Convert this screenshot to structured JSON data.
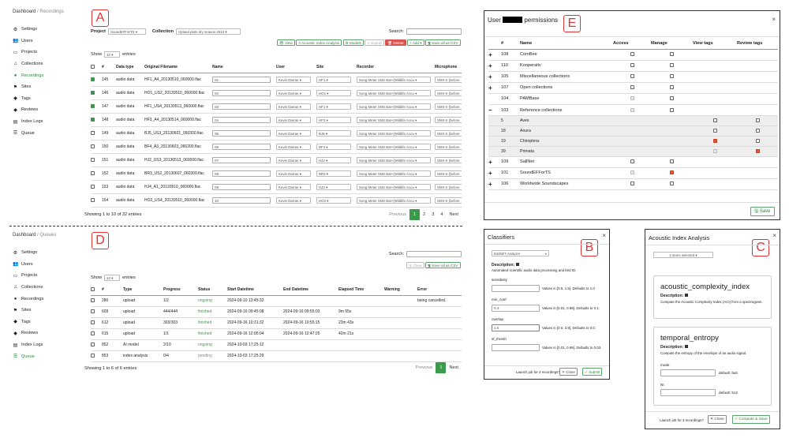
{
  "labels": {
    "a": "A",
    "b": "B",
    "c": "C",
    "d": "D",
    "e": "E"
  },
  "panel_a": {
    "breadcrumb": {
      "home": "Dashboard",
      "current": "Recordings"
    },
    "sidebar": [
      {
        "label": "Settings",
        "icon": "gear-icon",
        "glyph": "⚙",
        "active": false
      },
      {
        "label": "Users",
        "icon": "users-icon",
        "glyph": "👥",
        "active": false
      },
      {
        "label": "Projects",
        "icon": "monitor-icon",
        "glyph": "▭",
        "active": false
      },
      {
        "label": "Collections",
        "icon": "music-icon",
        "glyph": "♫",
        "active": false
      },
      {
        "label": "Recordings",
        "icon": "record-icon",
        "glyph": "●",
        "active": true
      },
      {
        "label": "Sites",
        "icon": "sites-icon",
        "glyph": "⚑",
        "active": false
      },
      {
        "label": "Tags",
        "icon": "tag-icon",
        "glyph": "◆",
        "active": false
      },
      {
        "label": "Reviews",
        "icon": "reviews-icon",
        "glyph": "◆",
        "active": false
      },
      {
        "label": "Index Logs",
        "icon": "index-logs-icon",
        "glyph": "▤",
        "active": false
      },
      {
        "label": "Queue",
        "icon": "queue-icon",
        "glyph": "☰",
        "active": false
      }
    ],
    "project_label": "Project",
    "project_value": "SoundEFForTS",
    "collection_label": "Collection",
    "collection_value": "Upland plots dry season 2013",
    "search_label": "Search:",
    "toolbar": {
      "view": "View",
      "aci": "Acoustic Index Analysis",
      "models": "Models",
      "export": "Export",
      "delete": "Delete",
      "add": "Add",
      "save_csv": "Save all as CSV"
    },
    "show": "Show",
    "show_value": "10",
    "entries": "entries",
    "columns": [
      "#",
      "Data type",
      "Original Filename",
      "Name",
      "User",
      "Site",
      "Recorder",
      "Microphone"
    ],
    "rows": [
      {
        "checked": true,
        "id": "145",
        "type": "audio data",
        "file": "HF1_A4_20130510_060000.flac",
        "name": "01",
        "user": "Kevin Darras",
        "site": "HF1",
        "recorder": "Song Meter SM2 Bat+(Wildlife Acou",
        "mic": "SMX-II (before"
      },
      {
        "checked": true,
        "id": "146",
        "type": "audio data",
        "file": "HO1_US2_20130510_060000.flac",
        "name": "02",
        "user": "Kevin Darras",
        "site": "HO1",
        "recorder": "Song Meter SM2 Bat+(Wildlife Acou",
        "mic": "SMX-II (before"
      },
      {
        "checked": true,
        "id": "147",
        "type": "audio data",
        "file": "HF1_US4_20130513_060000.flac",
        "name": "03",
        "user": "Kevin Darras",
        "site": "HF1",
        "recorder": "Song Meter SM2 Bat+(Wildlife Acou",
        "mic": "SMX-II (before"
      },
      {
        "checked": true,
        "id": "148",
        "type": "audio data",
        "file": "HF3_A4_20130514_060000.flac",
        "name": "04",
        "user": "Kevin Darras",
        "site": "HF3",
        "recorder": "Song Meter SM2 Bat+(Wildlife Acou",
        "mic": "SMX-II (before"
      },
      {
        "checked": false,
        "id": "149",
        "type": "audio data",
        "file": "BJ5_US3_20130601_060300.flac",
        "name": "05",
        "user": "Kevin Darras",
        "site": "BJ5",
        "recorder": "Song Meter SM2 Bat+(Wildlife Acou",
        "mic": "SMX-II (before"
      },
      {
        "checked": false,
        "id": "150",
        "type": "audio data",
        "file": "BF4_A3_20130603_060200.flac",
        "name": "06",
        "user": "Kevin Darras",
        "site": "BF4",
        "recorder": "Song Meter SM2 Bat+(Wildlife Acou",
        "mic": "SMX-II (before"
      },
      {
        "checked": false,
        "id": "151",
        "type": "audio data",
        "file": "HJ2_US3_20130513_060000.flac",
        "name": "07",
        "user": "Kevin Darras",
        "site": "HJ2",
        "recorder": "Song Meter SM2 Bat+(Wildlife Acou",
        "mic": "SMX-II (before"
      },
      {
        "checked": false,
        "id": "152",
        "type": "audio data",
        "file": "BR3_US2_20130607_060300.flac",
        "name": "08",
        "user": "Kevin Darras",
        "site": "BR3",
        "recorder": "Song Meter SM2 Bat+(Wildlife Acou",
        "mic": "SMX-II (before"
      },
      {
        "checked": false,
        "id": "153",
        "type": "audio data",
        "file": "HJ4_A1_20130510_060000.flac",
        "name": "09",
        "user": "Kevin Darras",
        "site": "HJ4",
        "recorder": "Song Meter SM2 Bat+(Wildlife Acou",
        "mic": "SMX-II (before"
      },
      {
        "checked": false,
        "id": "154",
        "type": "audio data",
        "file": "HO2_US4_20130510_060000.flac",
        "name": "10",
        "user": "Kevin Darras",
        "site": "HO2",
        "recorder": "Song Meter SM2 Bat+(Wildlife Acou",
        "mic": "SMX-II (before"
      }
    ],
    "footer": "Showing 1 to 10 of 32 entries",
    "pagination": [
      "Previous",
      "1",
      "2",
      "3",
      "4",
      "Next"
    ]
  },
  "panel_d": {
    "breadcrumb": {
      "home": "Dashboard",
      "current": "Queues"
    },
    "sidebar": [
      {
        "label": "Settings",
        "icon": "gear-icon",
        "glyph": "⚙",
        "active": false
      },
      {
        "label": "Users",
        "icon": "users-icon",
        "glyph": "👥",
        "active": false
      },
      {
        "label": "Projects",
        "icon": "monitor-icon",
        "glyph": "▭",
        "active": false
      },
      {
        "label": "Collections",
        "icon": "music-icon",
        "glyph": "♫",
        "active": false
      },
      {
        "label": "Recordings",
        "icon": "record-icon",
        "glyph": "●",
        "active": false
      },
      {
        "label": "Sites",
        "icon": "sites-icon",
        "glyph": "⚑",
        "active": false
      },
      {
        "label": "Tags",
        "icon": "tag-icon",
        "glyph": "◆",
        "active": false
      },
      {
        "label": "Reviews",
        "icon": "reviews-icon",
        "glyph": "◆",
        "active": false
      },
      {
        "label": "Index Logs",
        "icon": "index-logs-icon",
        "glyph": "▤",
        "active": false
      },
      {
        "label": "Queue",
        "icon": "queue-icon",
        "glyph": "☰",
        "active": true
      }
    ],
    "search_label": "Search:",
    "toolbar": {
      "clear": "Clear",
      "save_csv": "Save all as CSV"
    },
    "show": "Show",
    "show_value": "10",
    "entries": "entries",
    "columns": [
      "#",
      "Type",
      "Progress",
      "Status",
      "Start Datetime",
      "End Datetime",
      "Elapsed Time",
      "Warning",
      "Error"
    ],
    "rows": [
      {
        "id": "280",
        "type": "upload",
        "progress": "1/2",
        "status": "ongoing",
        "start": "2024-06-10 13:45:32",
        "end": "",
        "elapsed": "",
        "warning": "",
        "error": "being cancelled."
      },
      {
        "id": "609",
        "type": "upload",
        "progress": "444/444",
        "status": "finished",
        "start": "2024-09-16 09:45:08",
        "end": "2024-09-16 09:55:03",
        "elapsed": "9m 55s",
        "warning": "",
        "error": ""
      },
      {
        "id": "612",
        "type": "upload",
        "progress": "303/303",
        "status": "finished",
        "start": "2024-09-16 10:31:32",
        "end": "2024-09-16 10:55:15",
        "elapsed": "23m 43s",
        "warning": "",
        "error": ""
      },
      {
        "id": "615",
        "type": "upload",
        "progress": "1/1",
        "status": "finished",
        "start": "2024-09-16 12:05:04",
        "end": "2024-09-16 12:47:25",
        "elapsed": "42m 21s",
        "warning": "",
        "error": ""
      },
      {
        "id": "852",
        "type": "AI model",
        "progress": "2/10",
        "status": "ongoing",
        "start": "2024-10-03 17:25:12",
        "end": "",
        "elapsed": "",
        "warning": "",
        "error": ""
      },
      {
        "id": "853",
        "type": "index analysis",
        "progress": "0/4",
        "status": "pending",
        "start": "2024-10-03 17:25:29",
        "end": "",
        "elapsed": "",
        "warning": "",
        "error": ""
      }
    ],
    "footer": "Showing 1 to 6 of 6 entries",
    "pagination": [
      "Previous",
      "1",
      "Next"
    ]
  },
  "panel_e": {
    "title_pre": "User",
    "title_post": "permissions",
    "columns": [
      "#",
      "Name",
      "Access",
      "Manage",
      "View tags",
      "Review tags"
    ],
    "rows": [
      {
        "exp": "+",
        "id": "108",
        "name": "ComBee",
        "sub": false,
        "access": "off",
        "manage": "off",
        "view": "",
        "review": ""
      },
      {
        "exp": "+",
        "id": "110",
        "name": "Kooperativ",
        "sub": false,
        "access": "off",
        "manage": "off",
        "view": "",
        "review": ""
      },
      {
        "exp": "+",
        "id": "105",
        "name": "Miscellaneous collections",
        "sub": false,
        "access": "off",
        "manage": "off",
        "view": "",
        "review": ""
      },
      {
        "exp": "+",
        "id": "107",
        "name": "Open collections",
        "sub": false,
        "access": "off",
        "manage": "off",
        "view": "",
        "review": ""
      },
      {
        "exp": "",
        "id": "104",
        "name": "PAMBase",
        "sub": false,
        "access": "dis",
        "manage": "off",
        "view": "",
        "review": ""
      },
      {
        "exp": "−",
        "id": "103",
        "name": "Reference collections",
        "sub": false,
        "access": "dis",
        "manage": "off",
        "view": "",
        "review": ""
      },
      {
        "exp": "",
        "id": "5",
        "name": "Aves",
        "sub": true,
        "access": "",
        "manage": "",
        "view": "off",
        "review": "off"
      },
      {
        "exp": "",
        "id": "18",
        "name": "Anura",
        "sub": true,
        "access": "",
        "manage": "",
        "view": "off",
        "review": "off"
      },
      {
        "exp": "",
        "id": "19",
        "name": "Chiroptera",
        "sub": true,
        "access": "",
        "manage": "",
        "view": "red",
        "review": "off"
      },
      {
        "exp": "",
        "id": "39",
        "name": "Primata",
        "sub": true,
        "access": "",
        "manage": "",
        "view": "dis",
        "review": "red"
      },
      {
        "exp": "+",
        "id": "109",
        "name": "SallNet",
        "sub": false,
        "access": "off",
        "manage": "off",
        "view": "",
        "review": ""
      },
      {
        "exp": "+",
        "id": "101",
        "name": "SoundEFForTS",
        "sub": false,
        "access": "dis",
        "manage": "red",
        "view": "",
        "review": ""
      },
      {
        "exp": "+",
        "id": "106",
        "name": "Worldwide Soundscapes",
        "sub": false,
        "access": "off",
        "manage": "off",
        "view": "",
        "review": ""
      }
    ],
    "save": "Save"
  },
  "panel_b": {
    "title": "Classifiers",
    "selected": "BirdNET-Analyzer",
    "desc_label": "Description:",
    "desc": "Automated scientific audio data processing and bird ID.",
    "params": [
      {
        "name": "sensitivity",
        "value": "",
        "hint": "Values in [0.5, 1.5]. Defaults to 1.0"
      },
      {
        "name": "min_conf",
        "value": "0.3",
        "hint": "Values in [0.01, 0.99]. Defaults to 0.1."
      },
      {
        "name": "overlap",
        "value": "1.5",
        "hint": "Values in [0.0, 2.9]. Defaults to 0.0."
      },
      {
        "name": "sf_thresh",
        "value": "",
        "hint": "Values in [0.01, 0.99]. Defaults to 0.03."
      }
    ],
    "launch": "Launch job for 3 recordings?",
    "close": "Close",
    "submit": "Submit"
  },
  "panel_c": {
    "title": "Acoustic Index Analysis",
    "selected": "2 items selected",
    "cards": [
      {
        "name": "acoustic_complexity_index",
        "desc_label": "Description:",
        "desc": "Compute the Acoustic Complexity Index (ACI) from a spectrogram.",
        "params": []
      },
      {
        "name": "temporal_entropy",
        "desc_label": "Description:",
        "desc": "Compute the entropy of the envelope of an audio signal.",
        "params": [
          {
            "name": "mode",
            "hint": "default: fast"
          },
          {
            "name": "Nt",
            "hint": "default: 512"
          }
        ]
      }
    ],
    "launch": "Launch job for 3 recordings?",
    "close": "Close",
    "compute": "Compute & Save"
  }
}
